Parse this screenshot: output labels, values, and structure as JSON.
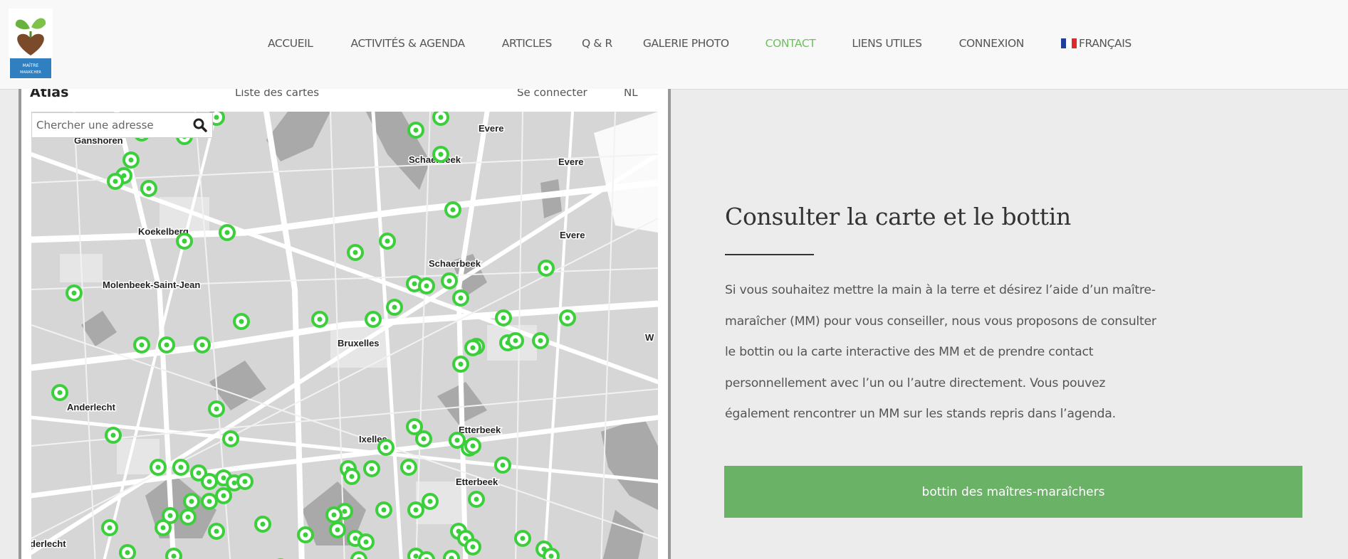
{
  "header": {
    "logo_text": "MAÎTRE MARAÎCHER",
    "nav": [
      {
        "label": "ACCUEIL",
        "active": false
      },
      {
        "label": "ACTIVITÉS & AGENDA",
        "active": false
      },
      {
        "label": "ARTICLES",
        "active": false
      },
      {
        "label": "Q & R",
        "active": false
      },
      {
        "label": "GALERIE PHOTO",
        "active": false
      },
      {
        "label": "CONTACT",
        "active": true
      },
      {
        "label": "LIENS UTILES",
        "active": false
      },
      {
        "label": "CONNEXION",
        "active": false
      }
    ],
    "language": "FRANÇAIS",
    "active_color": "#6fbf5f"
  },
  "map": {
    "topbar": {
      "title": "Atlas",
      "list_label": "Liste des cartes",
      "login_label": "Se connecter",
      "lang_label": "NL"
    },
    "search_placeholder": "Chercher une adresse",
    "place_labels": [
      "Ganshoren",
      "Evere",
      "Schaerbeek",
      "Evere",
      "Koekelberg",
      "Evere",
      "Schaerbeek",
      "Molenbeek-Saint-Jean",
      "Bruxelles",
      "W",
      "Anderlecht",
      "Ixelles",
      "Etterbeek",
      "Etterbeek",
      "derlecht"
    ],
    "marker_color": "#3ccf3c",
    "marker_count": 90
  },
  "content": {
    "heading": "Consulter la carte et le bottin",
    "paragraph_lines": [
      "Si vous souhaitez mettre la main à la terre et désirez l’aide d’un maître-",
      "maraîcher (MM) pour vous conseiller, nous vous proposons de consulter",
      "le bottin ou la carte interactive des MM et de prendre contact",
      "personnellement avec l’un ou l’autre directement. Vous pouvez",
      "également rencontrer un MM sur les stands repris dans l’agenda."
    ],
    "button_label": "bottin des maîtres-maraîchers",
    "button_color": "#6ab266"
  }
}
